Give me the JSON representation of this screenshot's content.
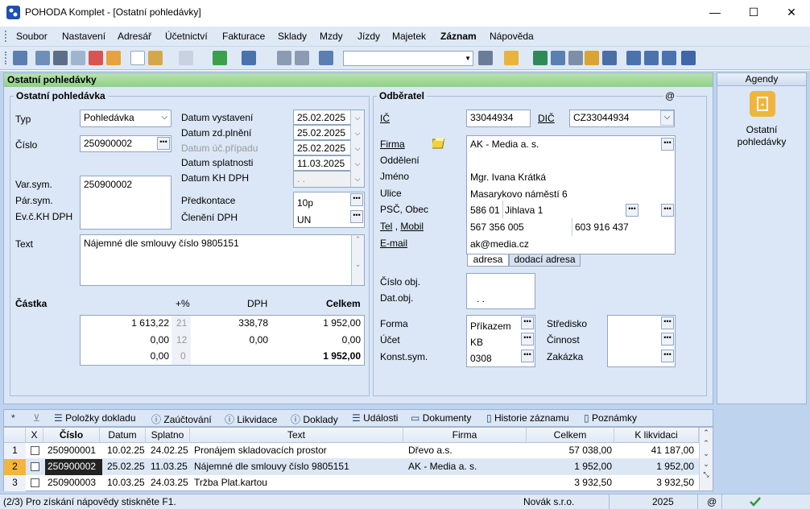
{
  "window": {
    "title": "POHODA Komplet - [Ostatní pohledávky]",
    "controls": {
      "minimize": "—",
      "maximize": "☐",
      "close": "✕"
    }
  },
  "menu": [
    "Soubor",
    "Nastavení",
    "Adresář",
    "Účetnictví",
    "Fakturace",
    "Sklady",
    "Mzdy",
    "Jízdy",
    "Majetek",
    "Záznam",
    "Nápověda"
  ],
  "form": {
    "header": "Ostatní pohledávky",
    "section_title": "Ostatní pohledávka",
    "typ": {
      "label": "Typ",
      "value": "Pohledávka"
    },
    "cislo": {
      "label": "Číslo",
      "value": "250900002"
    },
    "datum_vystaveni": {
      "label": "Datum vystavení",
      "value": "25.02.2025"
    },
    "datum_zdplneni": {
      "label": "Datum zd.plnění",
      "value": "25.02.2025"
    },
    "datum_ucpripadu": {
      "label": "Datum úč.případu",
      "value": "25.02.2025"
    },
    "datum_splatnosti": {
      "label": "Datum splatnosti",
      "value": "11.03.2025"
    },
    "datum_khdph": {
      "label": "Datum KH DPH",
      "value": ". ."
    },
    "varsym": {
      "label": "Var.sym.",
      "value": "250900002"
    },
    "parsym": {
      "label": "Pár.sym."
    },
    "evc": {
      "label": "Ev.č.KH DPH"
    },
    "predkontace": {
      "label": "Předkontace",
      "value": "10p"
    },
    "cleneni": {
      "label": "Členění DPH",
      "value": "UN"
    },
    "text": {
      "label": "Text",
      "value": "Nájemné dle smlouvy číslo 9805151"
    },
    "castka": {
      "label": "Částka",
      "plus": "+%",
      "dph": "DPH",
      "celkem": "Celkem",
      "rows": [
        {
          "zaklad": "1 613,22",
          "pct": "21",
          "dph": "338,78",
          "celkem": "1 952,00"
        },
        {
          "zaklad": "0,00",
          "pct": "12",
          "dph": "0,00",
          "celkem": "0,00"
        },
        {
          "zaklad": "0,00",
          "pct": "0",
          "dph": "",
          "celkem": "1 952,00"
        }
      ]
    }
  },
  "odberatel": {
    "title": "Odběratel",
    "at": "@",
    "ic": {
      "label": "IČ",
      "value": "33044934"
    },
    "dic": {
      "label": "DIČ",
      "value": "CZ33044934"
    },
    "firma": {
      "label": "Firma",
      "value": "AK - Media a. s."
    },
    "oddeleni": {
      "label": "Oddělení",
      "value": ""
    },
    "jmeno": {
      "label": "Jméno",
      "value": "Mgr. Ivana Krátká"
    },
    "ulice": {
      "label": "Ulice",
      "value": "Masarykovo náměstí 6"
    },
    "psc": {
      "label": "PSČ, Obec",
      "psc": "586 01",
      "obec": "Jihlava 1"
    },
    "tel": {
      "label_tel": "Tel",
      "label_sep": ",",
      "label_mobil": "Mobil",
      "tel": "567 356 005",
      "mobil": "603 916 437"
    },
    "email": {
      "label": "E-mail",
      "value": "ak@media.cz"
    },
    "tabs": [
      "adresa",
      "dodací adresa"
    ],
    "cislo_obj": {
      "label": "Číslo obj."
    },
    "dat_obj": {
      "label": "Dat.obj.",
      "value": ". ."
    },
    "forma": {
      "label": "Forma",
      "value": "Příkazem"
    },
    "ucet": {
      "label": "Účet",
      "value": "KB"
    },
    "konst": {
      "label": "Konst.sym.",
      "value": "0308"
    },
    "stredisko": {
      "label": "Středisko"
    },
    "cinnost": {
      "label": "Činnost"
    },
    "zakazka": {
      "label": "Zakázka"
    }
  },
  "agendy": {
    "title": "Agendy",
    "item_line1": "Ostatní",
    "item_line2": "pohledávky"
  },
  "bottom_tabs": [
    "*",
    "",
    "Položky dokladu",
    "Zaúčtování",
    "Likvidace",
    "Doklady",
    "Události",
    "Dokumenty",
    "Historie záznamu",
    "Poznámky"
  ],
  "grid": {
    "columns": [
      "X",
      "Číslo",
      "Datum",
      "Splatno",
      "Text",
      "Firma",
      "Celkem",
      "K likvidaci"
    ],
    "rows": [
      {
        "n": "1",
        "cislo": "250900001",
        "datum": "10.02.25",
        "splatno": "24.02.25",
        "text": "Pronájem skladovacích prostor",
        "firma": "Dřevo a.s.",
        "celkem": "57 038,00",
        "klikvidaci": "41 187,00"
      },
      {
        "n": "2",
        "cislo": "250900002",
        "datum": "25.02.25",
        "splatno": "11.03.25",
        "text": "Nájemné dle smlouvy číslo 9805151",
        "firma": "AK - Media a. s.",
        "celkem": "1 952,00",
        "klikvidaci": "1 952,00"
      },
      {
        "n": "3",
        "cislo": "250900003",
        "datum": "10.03.25",
        "splatno": "24.03.25",
        "text": "Tržba Plat.kartou",
        "firma": "",
        "celkem": "3 932,50",
        "klikvidaci": "3 932,50"
      }
    ]
  },
  "status": {
    "hint": "(2/3) Pro získání nápovědy stiskněte F1.",
    "company": "Novák s.r.o.",
    "year": "2025",
    "at": "@"
  }
}
